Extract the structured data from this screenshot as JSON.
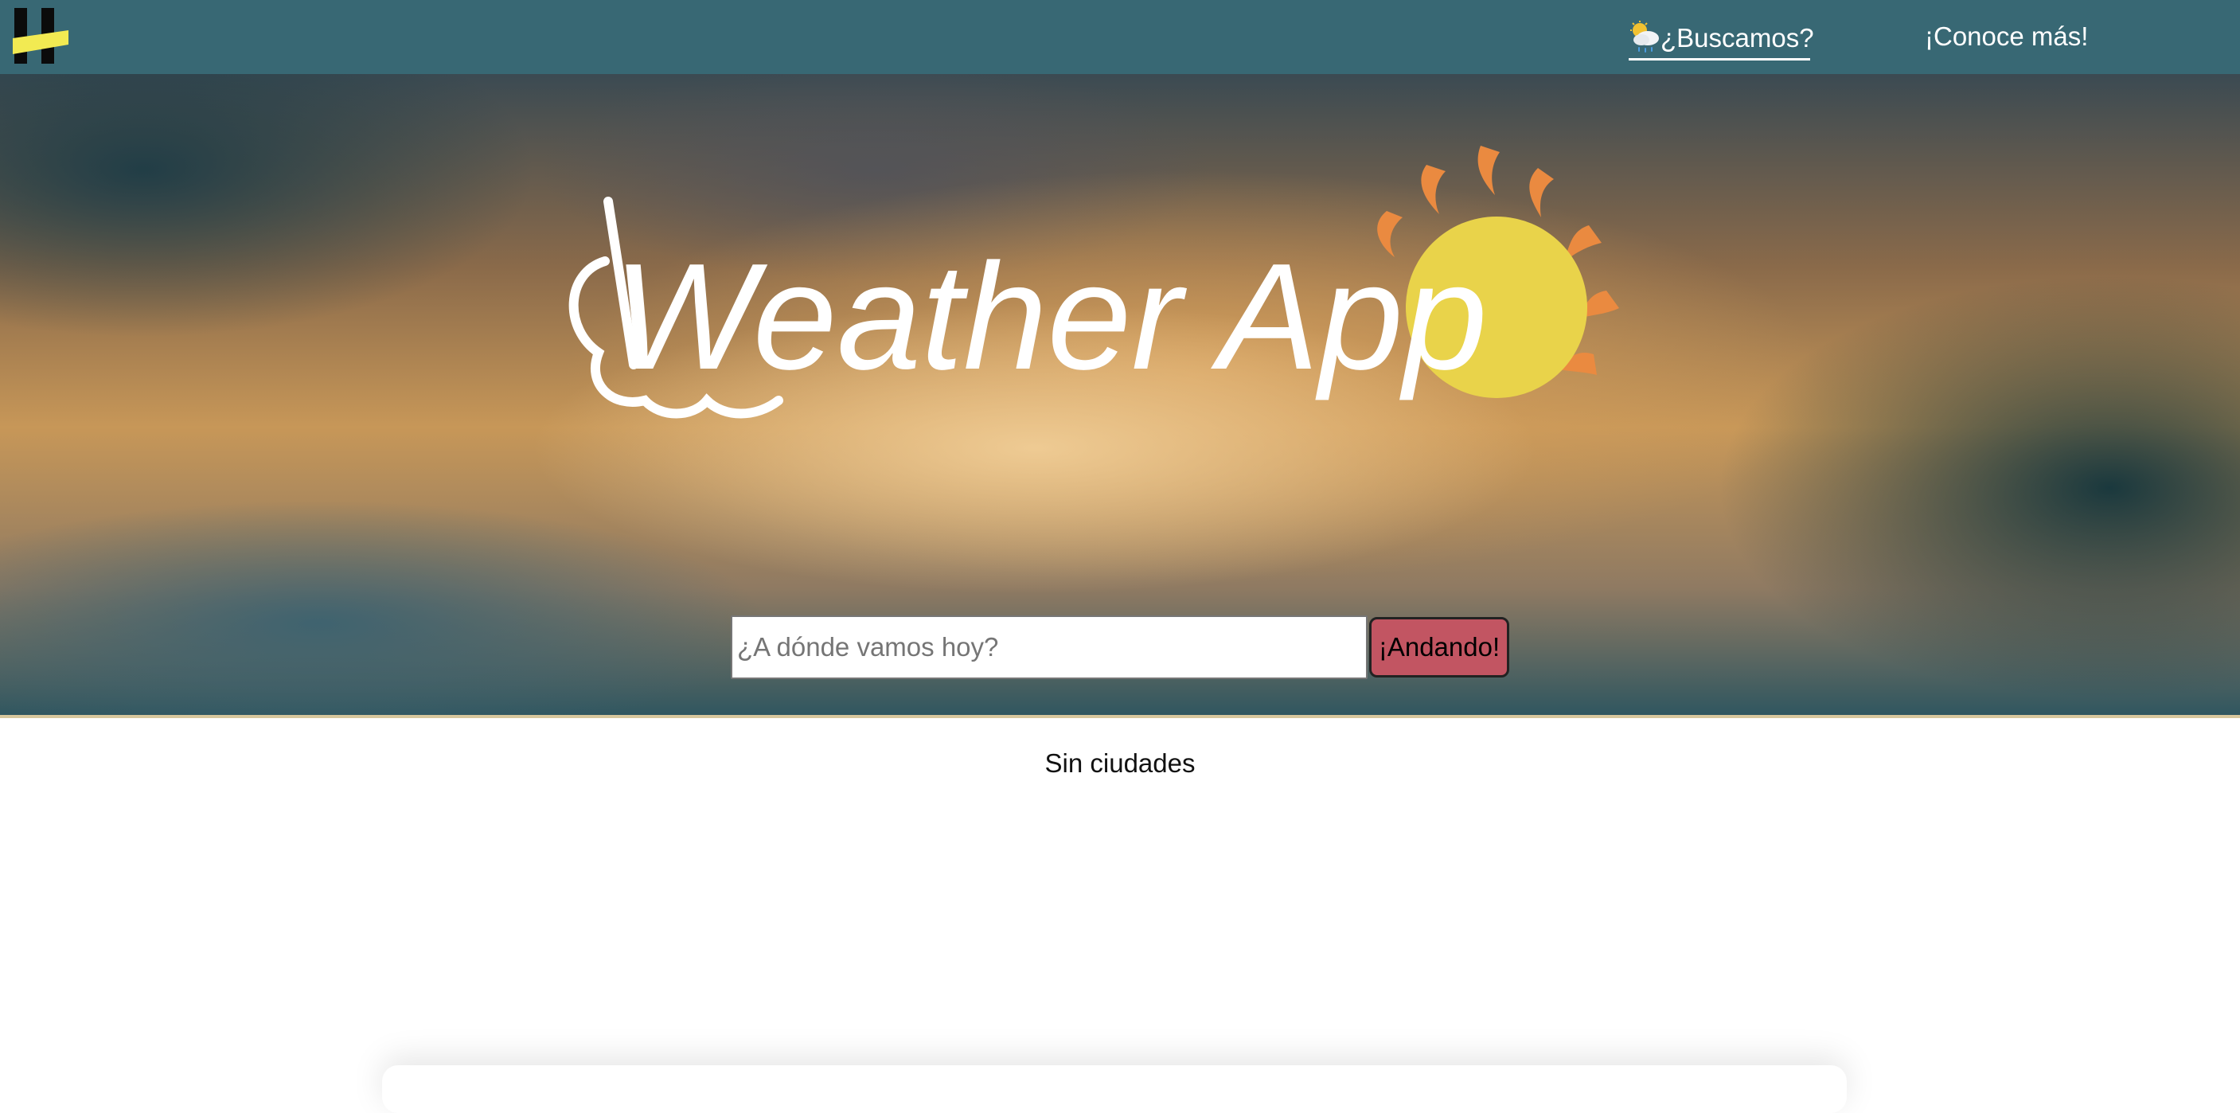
{
  "navbar": {
    "logo_icon": "henry-logo-icon",
    "links": [
      {
        "label": "¿Buscamos?",
        "icon": "sun-cloud-rain-icon",
        "active": true
      },
      {
        "label": "¡Conoce más!",
        "active": false
      }
    ],
    "background_color": "#386874"
  },
  "hero": {
    "title": "Weather App",
    "colors": {
      "sun": "#e9d34a",
      "rays": "#ea8a40",
      "title": "#ffffff"
    }
  },
  "search": {
    "placeholder": "¿A dónde vamos hoy?",
    "value": "",
    "button_label": "¡Andando!",
    "button_color": "#c25562"
  },
  "content": {
    "empty_message": "Sin ciudades"
  }
}
